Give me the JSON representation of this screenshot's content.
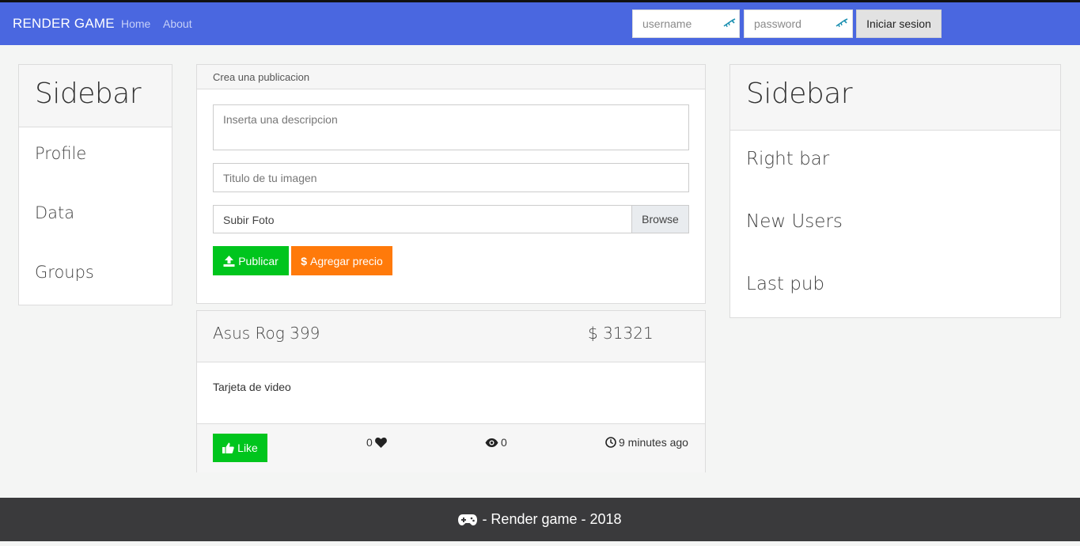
{
  "navbar": {
    "brand": "RENDER GAME",
    "links": [
      "Home",
      "About"
    ],
    "username_placeholder": "username",
    "password_placeholder": "password",
    "login_label": "Iniciar sesion",
    "background_color": "#4a67e0"
  },
  "left_sidebar": {
    "title": "Sidebar",
    "items": [
      "Profile",
      "Data",
      "Groups"
    ]
  },
  "composer": {
    "header": "Crea una publicacion",
    "description_placeholder": "Inserta una descripcion",
    "image_title_placeholder": "Titulo de tu imagen",
    "file_label": "Subir Foto",
    "browse_label": "Browse",
    "publish_label": "Publicar",
    "add_price_label": "Agregar precio",
    "publish_color": "#00c51d",
    "add_price_color": "#ff7a0a"
  },
  "post": {
    "title": "Asus Rog 399",
    "price": "$ 31321",
    "description": "Tarjeta de video",
    "like_label": "Like",
    "likes_count": "0",
    "views_count": "0",
    "time_ago": "9 minutes ago"
  },
  "right_sidebar": {
    "title": "Sidebar",
    "items": [
      "Right bar",
      "New Users",
      "Last pub"
    ]
  },
  "footer": {
    "text": "- Render game - 2018"
  }
}
